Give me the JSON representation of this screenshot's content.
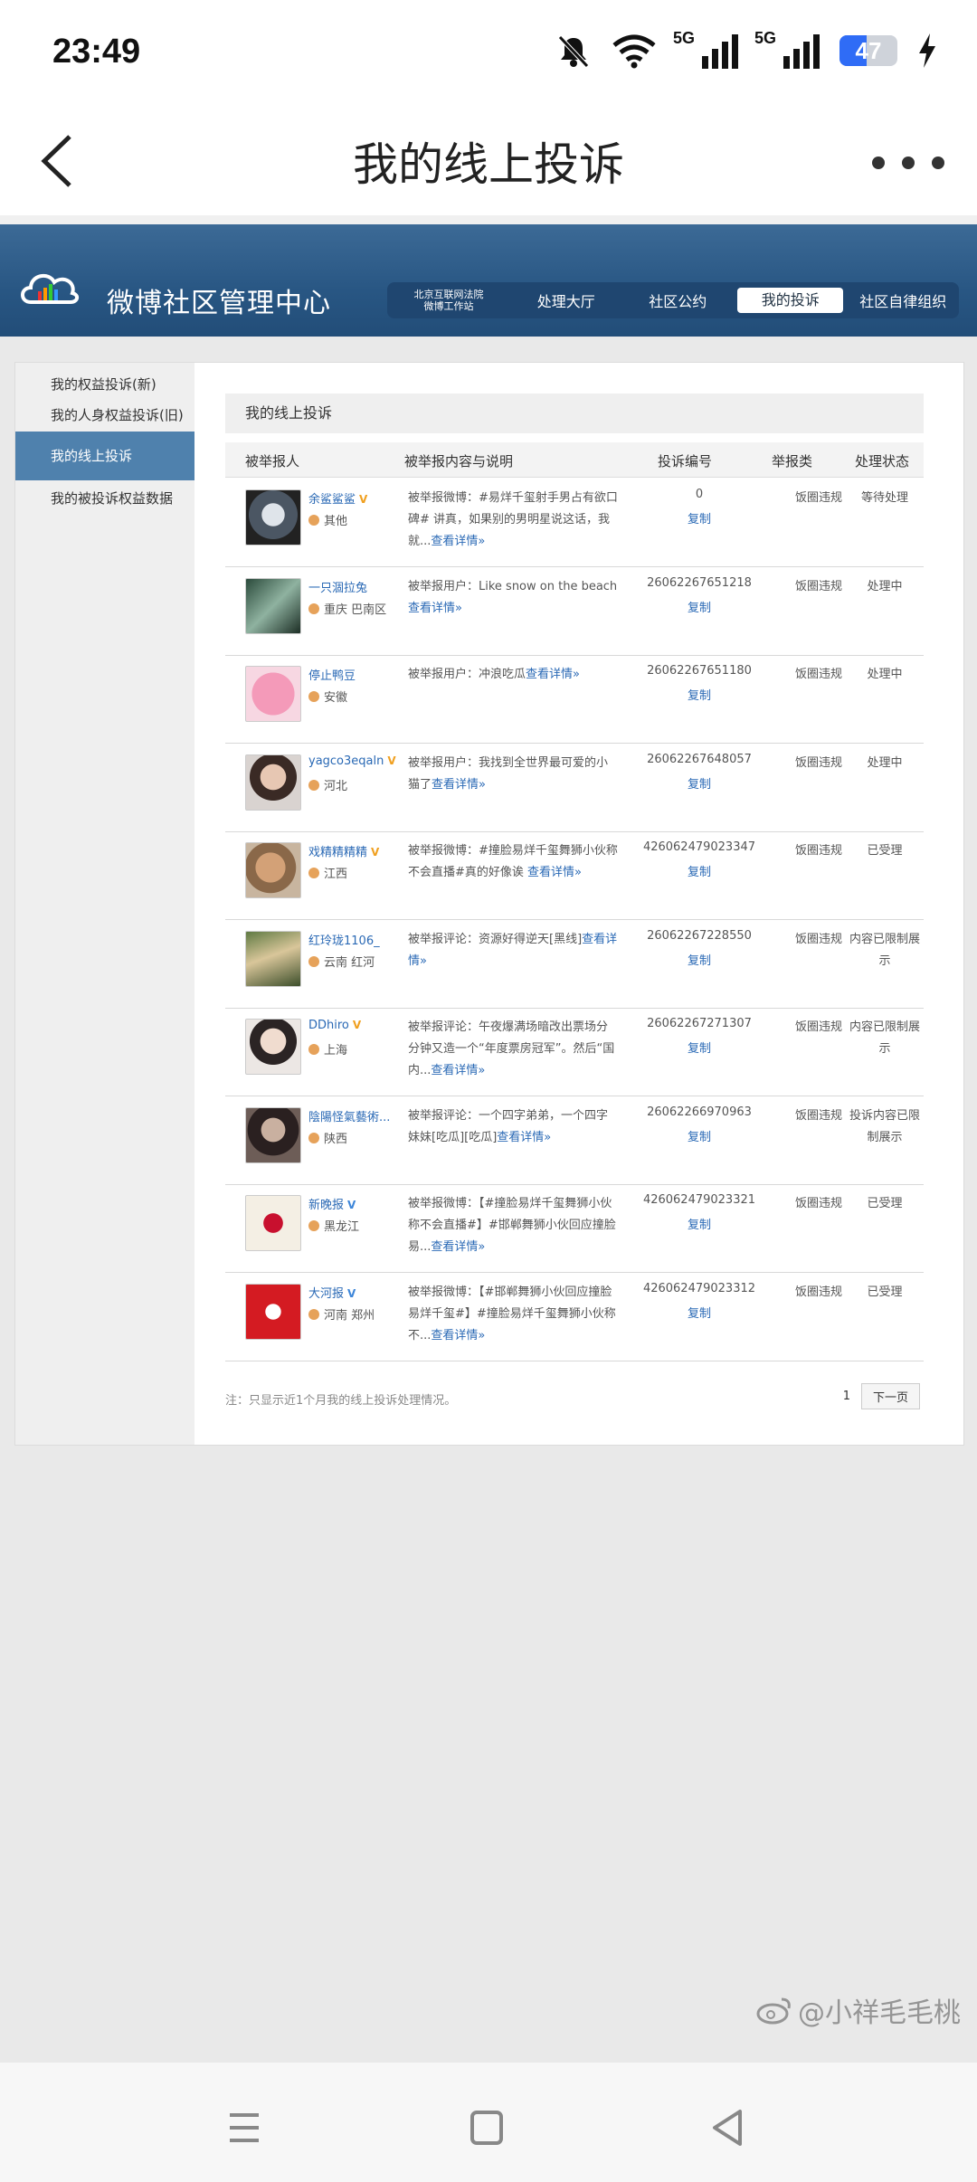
{
  "status": {
    "time": "23:49",
    "signal1_label": "5G",
    "signal2_label": "5G",
    "battery": "47",
    "battery_level": 0.47
  },
  "appbar": {
    "title": "我的线上投诉"
  },
  "banner": {
    "logo_text": "微博社区管理中心",
    "nav": [
      "北京互联网法院\n微博工作站",
      "处理大厅",
      "社区公约",
      "我的投诉",
      "社区自律组织"
    ],
    "nav_court_line1": "北京互联网法院",
    "nav_court_line2": "微博工作站",
    "nav_hall": "处理大厅",
    "nav_convention": "社区公约",
    "nav_mine": "我的投诉",
    "nav_org": "社区自律组织"
  },
  "sidebar": {
    "items": [
      {
        "label": "我的权益投诉(新)"
      },
      {
        "label": "我的人身权益投诉(旧)"
      },
      {
        "label": "我的线上投诉"
      },
      {
        "label": "我的被投诉权益数据"
      }
    ]
  },
  "content": {
    "title": "我的线上投诉",
    "headers": [
      "被举报人",
      "被举报内容与说明",
      "投诉编号",
      "举报类",
      "处理状态"
    ],
    "copy_label": "复制",
    "rows": [
      {
        "name": "余鲨鲨鲨",
        "vbadge": "V",
        "vcolor": "gold",
        "loc": "其他",
        "desc": "被举报微博：#易烊千玺射手男占有欲口碑# 讲真，如果别的男明星说这话，我就...",
        "more": "查看详情»",
        "id": "0",
        "cat": "饭圈违规",
        "state": "等待处理"
      },
      {
        "name": "一只涸拉兔",
        "vbadge": "",
        "vcolor": "",
        "loc": "重庆 巴南区",
        "desc": "被举报用户：Like snow on the beach",
        "more": "查看详情»",
        "id": "26062267651218",
        "cat": "饭圈违规",
        "state": "处理中"
      },
      {
        "name": "停止鸭豆",
        "vbadge": "",
        "vcolor": "",
        "loc": "安徽",
        "desc": "被举报用户：冲浪吃瓜",
        "more": "查看详情»",
        "id": "26062267651180",
        "cat": "饭圈违规",
        "state": "处理中"
      },
      {
        "name": "yagco3eqaln",
        "vbadge": "V",
        "vcolor": "gold",
        "loc": "河北",
        "desc": "被举报用户：我找到全世界最可爱的小猫了",
        "more": "查看详情»",
        "id": "26062267648057",
        "cat": "饭圈违规",
        "state": "处理中"
      },
      {
        "name": "戏精精精精",
        "vbadge": "V",
        "vcolor": "gold",
        "loc": "江西",
        "desc": "被举报微博：#撞脸易烊千玺舞狮小伙称不会直播#真的好像诶 ",
        "more": "查看详情»",
        "id": "426062479023347",
        "cat": "饭圈违规",
        "state": "已受理"
      },
      {
        "name": "红玲珑1106_",
        "vbadge": "",
        "vcolor": "",
        "loc": "云南 红河",
        "desc": "被举报评论：资源好得逆天[黑线]",
        "more": "查看详情»",
        "id": "26062267228550",
        "cat": "饭圈违规",
        "state": "内容已限制展示"
      },
      {
        "name": "DDhiro",
        "vbadge": "V",
        "vcolor": "gold",
        "loc": "上海",
        "desc": "被举报评论：午夜爆满场暗改出票场分分钟又造一个“年度票房冠军”。然后“国内...",
        "more": "查看详情»",
        "id": "26062267271307",
        "cat": "饭圈违规",
        "state": "内容已限制展示"
      },
      {
        "name": "陰陽怪氣藝術...",
        "vbadge": "",
        "vcolor": "",
        "loc": "陕西",
        "desc": "被举报评论：一个四字弟弟，一个四字妹妹[吃瓜][吃瓜]",
        "more": "查看详情»",
        "id": "26062266970963",
        "cat": "饭圈违规",
        "state": "投诉内容已限制展示"
      },
      {
        "name": "新晚报",
        "vbadge": "V",
        "vcolor": "blue",
        "loc": "黑龙江",
        "desc": "被举报微博：【#撞脸易烊千玺舞狮小伙称不会直播#】#邯郸舞狮小伙回应撞脸易...",
        "more": "查看详情»",
        "id": "426062479023321",
        "cat": "饭圈违规",
        "state": "已受理"
      },
      {
        "name": "大河报",
        "vbadge": "V",
        "vcolor": "blue",
        "loc": "河南 郑州",
        "desc": "被举报微博：【#邯郸舞狮小伙回应撞脸易烊千玺#】#撞脸易烊千玺舞狮小伙称不...",
        "more": "查看详情»",
        "id": "426062479023312",
        "cat": "饭圈违规",
        "state": "已受理"
      }
    ],
    "footer_note": "注：只显示近1个月我的线上投诉处理情况。",
    "page_number": "1",
    "next_page": "下一页"
  },
  "watermark": "@小祥毛毛桃",
  "colors": {
    "banner": "#285683",
    "link": "#2a69b5",
    "sidebar_active": "#4f81ad"
  }
}
